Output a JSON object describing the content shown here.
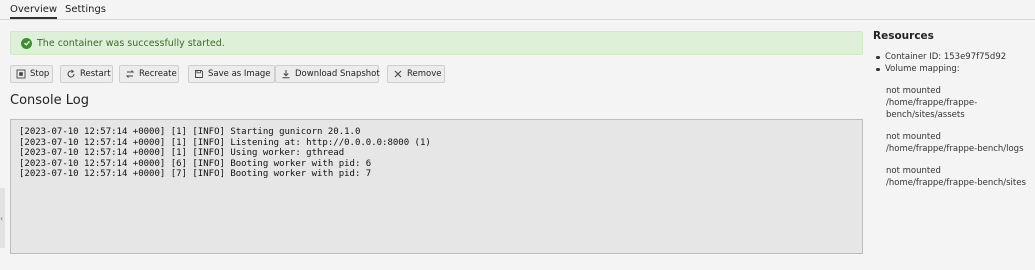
{
  "tabs": {
    "overview": "Overview",
    "settings": "Settings"
  },
  "alert": {
    "message": "The container was successfully started."
  },
  "toolbar": {
    "stop": "Stop",
    "restart": "Restart",
    "recreate": "Recreate",
    "save_image": "Save as Image",
    "download_snapshot": "Download Snapshot",
    "remove": "Remove"
  },
  "console": {
    "title": "Console Log",
    "lines": [
      "[2023-07-10 12:57:14 +0000] [1] [INFO] Starting gunicorn 20.1.0",
      "[2023-07-10 12:57:14 +0000] [1] [INFO] Listening at: http://0.0.0.0:8000 (1)",
      "[2023-07-10 12:57:14 +0000] [1] [INFO] Using worker: gthread",
      "[2023-07-10 12:57:14 +0000] [6] [INFO] Booting worker with pid: 6",
      "[2023-07-10 12:57:14 +0000] [7] [INFO] Booting worker with pid: 7"
    ]
  },
  "resources": {
    "title": "Resources",
    "container_id": "Container ID: 153e97f75d92",
    "volume_label": "Volume mapping:",
    "mappings": [
      {
        "status": "not mounted",
        "path1": "/home/frappe/frappe-",
        "path2": "bench/sites/assets"
      },
      {
        "status": "not mounted",
        "path1": "/home/frappe/frappe-bench/logs",
        "path2": ""
      },
      {
        "status": "not mounted",
        "path1": "/home/frappe/frappe-bench/sites",
        "path2": ""
      }
    ]
  },
  "edge_arrow": "‹",
  "colors": {
    "success_bg": "#dff0d8",
    "success_text": "#3c6a2b",
    "console_bg": "#e6e6e6"
  },
  "icons": [
    "check-circle-icon",
    "stop-icon",
    "restart-icon",
    "recreate-icon",
    "save-image-icon",
    "download-icon",
    "remove-icon"
  ]
}
